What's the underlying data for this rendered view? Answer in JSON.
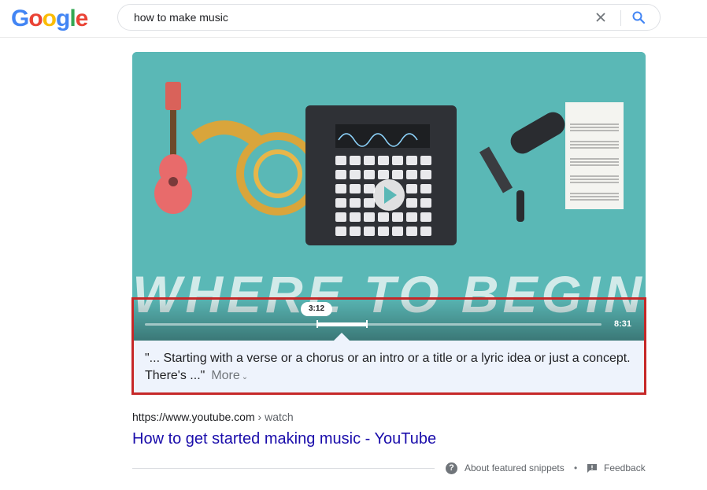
{
  "header": {
    "logo_letters": [
      "G",
      "o",
      "o",
      "g",
      "l",
      "e"
    ],
    "logo_colors": [
      "#4285F4",
      "#EA4335",
      "#FBBC05",
      "#4285F4",
      "#34A853",
      "#EA4335"
    ],
    "search_value": "how to make music"
  },
  "video": {
    "overlay_title": "WHERE TO BEGIN",
    "current_time": "3:12",
    "duration": "8:31",
    "progress_fraction": 0.376,
    "background_color": "#5ab8b6"
  },
  "transcript": {
    "text": "\"... Starting with a verse or a chorus or an intro or a title or a lyric idea or just a concept. There's ...\"",
    "more_label": "More"
  },
  "result": {
    "url_domain": "https://www.youtube.com",
    "url_path": " › watch",
    "title": "How to get started making music - YouTube"
  },
  "footer": {
    "about_label": "About featured snippets",
    "separator": "•",
    "feedback_label": "Feedback"
  },
  "colors": {
    "highlight_border": "#c62828",
    "link": "#1a0dab",
    "transcript_bg": "#eef3fc"
  }
}
